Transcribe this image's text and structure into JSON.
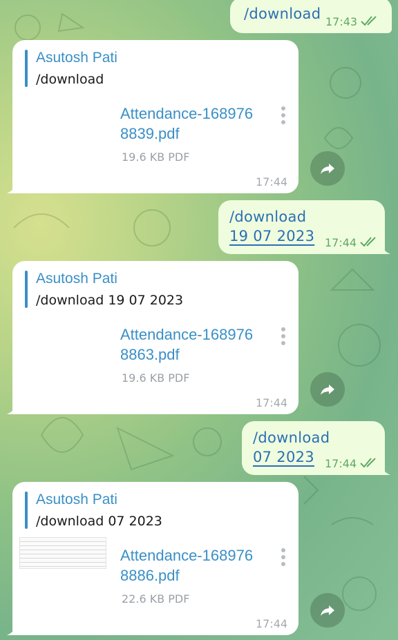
{
  "chat": {
    "messages": [
      {
        "kind": "out",
        "lines": [
          "/download"
        ],
        "time": "17:43"
      },
      {
        "kind": "in",
        "sender": "Asutosh Pati",
        "command": "/download",
        "file_line1": "Attendance-168976",
        "file_line2": "8839.pdf",
        "file_size": "19.6 KB PDF",
        "time": "17:44"
      },
      {
        "kind": "out",
        "lines": [
          "/download",
          "19 07 2023"
        ],
        "time": "17:44"
      },
      {
        "kind": "in",
        "sender": "Asutosh Pati",
        "command": "/download 19 07 2023",
        "file_line1": "Attendance-168976",
        "file_line2": "8863.pdf",
        "file_size": "19.6 KB PDF",
        "time": "17:44"
      },
      {
        "kind": "out",
        "lines": [
          "/download",
          "07 2023"
        ],
        "time": "17:44"
      },
      {
        "kind": "in",
        "sender": "Asutosh Pati",
        "command": "/download 07 2023",
        "file_line1": "Attendance-168976",
        "file_line2": "8886.pdf",
        "file_size": "22.6 KB PDF",
        "time": "17:44"
      }
    ]
  },
  "icons": {
    "read_receipt": "double-check-icon",
    "file_menu": "more-vertical-icon",
    "share": "forward-arrow-icon"
  },
  "colors": {
    "outgoing_bubble": "#effdde",
    "incoming_bubble": "#ffffff",
    "link": "#2a6fb4",
    "sender_name": "#3a8fc6",
    "time_out": "#5fa864",
    "time_in": "#a5a9ad"
  }
}
